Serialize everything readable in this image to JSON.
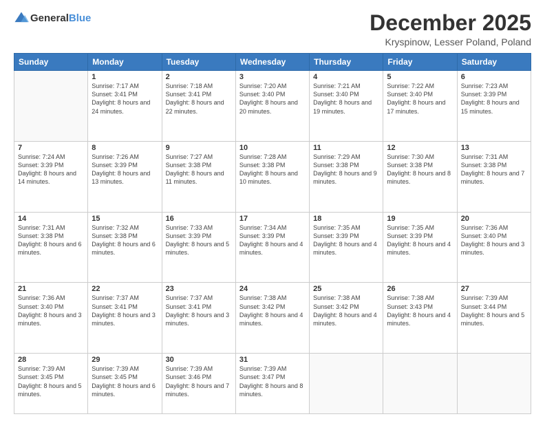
{
  "header": {
    "logo": {
      "general": "General",
      "blue": "Blue"
    },
    "title": "December 2025",
    "location": "Kryspinow, Lesser Poland, Poland"
  },
  "weekdays": [
    "Sunday",
    "Monday",
    "Tuesday",
    "Wednesday",
    "Thursday",
    "Friday",
    "Saturday"
  ],
  "weeks": [
    [
      {
        "day": "",
        "sunrise": "",
        "sunset": "",
        "daylight": ""
      },
      {
        "day": "1",
        "sunrise": "Sunrise: 7:17 AM",
        "sunset": "Sunset: 3:41 PM",
        "daylight": "Daylight: 8 hours and 24 minutes."
      },
      {
        "day": "2",
        "sunrise": "Sunrise: 7:18 AM",
        "sunset": "Sunset: 3:41 PM",
        "daylight": "Daylight: 8 hours and 22 minutes."
      },
      {
        "day": "3",
        "sunrise": "Sunrise: 7:20 AM",
        "sunset": "Sunset: 3:40 PM",
        "daylight": "Daylight: 8 hours and 20 minutes."
      },
      {
        "day": "4",
        "sunrise": "Sunrise: 7:21 AM",
        "sunset": "Sunset: 3:40 PM",
        "daylight": "Daylight: 8 hours and 19 minutes."
      },
      {
        "day": "5",
        "sunrise": "Sunrise: 7:22 AM",
        "sunset": "Sunset: 3:40 PM",
        "daylight": "Daylight: 8 hours and 17 minutes."
      },
      {
        "day": "6",
        "sunrise": "Sunrise: 7:23 AM",
        "sunset": "Sunset: 3:39 PM",
        "daylight": "Daylight: 8 hours and 15 minutes."
      }
    ],
    [
      {
        "day": "7",
        "sunrise": "Sunrise: 7:24 AM",
        "sunset": "Sunset: 3:39 PM",
        "daylight": "Daylight: 8 hours and 14 minutes."
      },
      {
        "day": "8",
        "sunrise": "Sunrise: 7:26 AM",
        "sunset": "Sunset: 3:39 PM",
        "daylight": "Daylight: 8 hours and 13 minutes."
      },
      {
        "day": "9",
        "sunrise": "Sunrise: 7:27 AM",
        "sunset": "Sunset: 3:38 PM",
        "daylight": "Daylight: 8 hours and 11 minutes."
      },
      {
        "day": "10",
        "sunrise": "Sunrise: 7:28 AM",
        "sunset": "Sunset: 3:38 PM",
        "daylight": "Daylight: 8 hours and 10 minutes."
      },
      {
        "day": "11",
        "sunrise": "Sunrise: 7:29 AM",
        "sunset": "Sunset: 3:38 PM",
        "daylight": "Daylight: 8 hours and 9 minutes."
      },
      {
        "day": "12",
        "sunrise": "Sunrise: 7:30 AM",
        "sunset": "Sunset: 3:38 PM",
        "daylight": "Daylight: 8 hours and 8 minutes."
      },
      {
        "day": "13",
        "sunrise": "Sunrise: 7:31 AM",
        "sunset": "Sunset: 3:38 PM",
        "daylight": "Daylight: 8 hours and 7 minutes."
      }
    ],
    [
      {
        "day": "14",
        "sunrise": "Sunrise: 7:31 AM",
        "sunset": "Sunset: 3:38 PM",
        "daylight": "Daylight: 8 hours and 6 minutes."
      },
      {
        "day": "15",
        "sunrise": "Sunrise: 7:32 AM",
        "sunset": "Sunset: 3:38 PM",
        "daylight": "Daylight: 8 hours and 6 minutes."
      },
      {
        "day": "16",
        "sunrise": "Sunrise: 7:33 AM",
        "sunset": "Sunset: 3:39 PM",
        "daylight": "Daylight: 8 hours and 5 minutes."
      },
      {
        "day": "17",
        "sunrise": "Sunrise: 7:34 AM",
        "sunset": "Sunset: 3:39 PM",
        "daylight": "Daylight: 8 hours and 4 minutes."
      },
      {
        "day": "18",
        "sunrise": "Sunrise: 7:35 AM",
        "sunset": "Sunset: 3:39 PM",
        "daylight": "Daylight: 8 hours and 4 minutes."
      },
      {
        "day": "19",
        "sunrise": "Sunrise: 7:35 AM",
        "sunset": "Sunset: 3:39 PM",
        "daylight": "Daylight: 8 hours and 4 minutes."
      },
      {
        "day": "20",
        "sunrise": "Sunrise: 7:36 AM",
        "sunset": "Sunset: 3:40 PM",
        "daylight": "Daylight: 8 hours and 3 minutes."
      }
    ],
    [
      {
        "day": "21",
        "sunrise": "Sunrise: 7:36 AM",
        "sunset": "Sunset: 3:40 PM",
        "daylight": "Daylight: 8 hours and 3 minutes."
      },
      {
        "day": "22",
        "sunrise": "Sunrise: 7:37 AM",
        "sunset": "Sunset: 3:41 PM",
        "daylight": "Daylight: 8 hours and 3 minutes."
      },
      {
        "day": "23",
        "sunrise": "Sunrise: 7:37 AM",
        "sunset": "Sunset: 3:41 PM",
        "daylight": "Daylight: 8 hours and 3 minutes."
      },
      {
        "day": "24",
        "sunrise": "Sunrise: 7:38 AM",
        "sunset": "Sunset: 3:42 PM",
        "daylight": "Daylight: 8 hours and 4 minutes."
      },
      {
        "day": "25",
        "sunrise": "Sunrise: 7:38 AM",
        "sunset": "Sunset: 3:42 PM",
        "daylight": "Daylight: 8 hours and 4 minutes."
      },
      {
        "day": "26",
        "sunrise": "Sunrise: 7:38 AM",
        "sunset": "Sunset: 3:43 PM",
        "daylight": "Daylight: 8 hours and 4 minutes."
      },
      {
        "day": "27",
        "sunrise": "Sunrise: 7:39 AM",
        "sunset": "Sunset: 3:44 PM",
        "daylight": "Daylight: 8 hours and 5 minutes."
      }
    ],
    [
      {
        "day": "28",
        "sunrise": "Sunrise: 7:39 AM",
        "sunset": "Sunset: 3:45 PM",
        "daylight": "Daylight: 8 hours and 5 minutes."
      },
      {
        "day": "29",
        "sunrise": "Sunrise: 7:39 AM",
        "sunset": "Sunset: 3:45 PM",
        "daylight": "Daylight: 8 hours and 6 minutes."
      },
      {
        "day": "30",
        "sunrise": "Sunrise: 7:39 AM",
        "sunset": "Sunset: 3:46 PM",
        "daylight": "Daylight: 8 hours and 7 minutes."
      },
      {
        "day": "31",
        "sunrise": "Sunrise: 7:39 AM",
        "sunset": "Sunset: 3:47 PM",
        "daylight": "Daylight: 8 hours and 8 minutes."
      },
      {
        "day": "",
        "sunrise": "",
        "sunset": "",
        "daylight": ""
      },
      {
        "day": "",
        "sunrise": "",
        "sunset": "",
        "daylight": ""
      },
      {
        "day": "",
        "sunrise": "",
        "sunset": "",
        "daylight": ""
      }
    ]
  ]
}
